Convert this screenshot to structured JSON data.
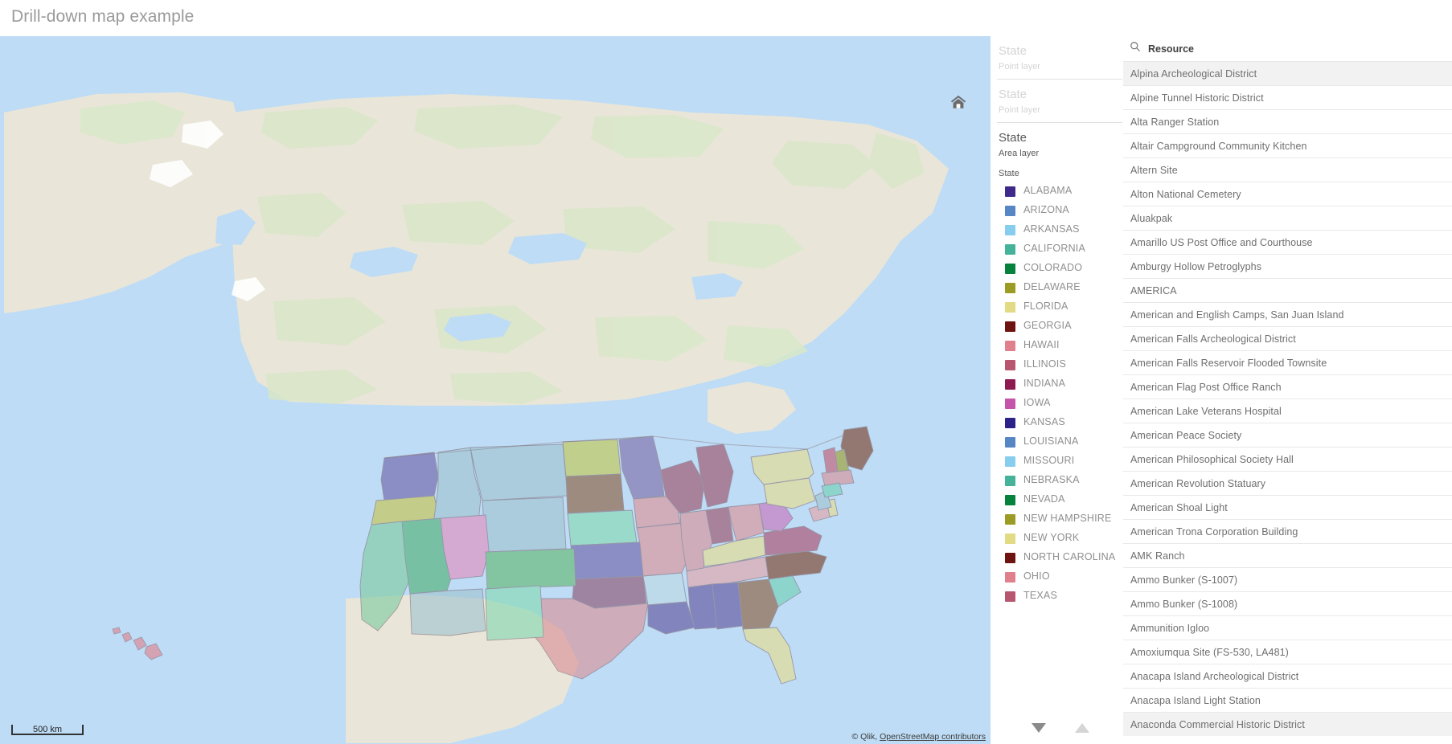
{
  "header": {
    "title": "Drill-down map example"
  },
  "map": {
    "home_icon": "home-icon",
    "scale_label": "500 km",
    "attribution_prefix": "© Qlik, ",
    "attribution_link": "OpenStreetMap contributors",
    "water_color": "#bedcf5",
    "land_color": "#e9e6d9",
    "green_color": "#d9e7c8"
  },
  "legend": {
    "groups": [
      {
        "title": "State",
        "subtitle": "Point layer",
        "dim": true
      },
      {
        "title": "State",
        "subtitle": "Point layer",
        "dim": true
      },
      {
        "title": "State",
        "subtitle": "Area layer",
        "dim": false,
        "dimension_name": "State"
      }
    ],
    "items": [
      {
        "label": "ALABAMA",
        "color": "#3f2a8c"
      },
      {
        "label": "ARIZONA",
        "color": "#5786c5"
      },
      {
        "label": "ARKANSAS",
        "color": "#87cdee"
      },
      {
        "label": "CALIFORNIA",
        "color": "#45b39a"
      },
      {
        "label": "COLORADO",
        "color": "#07823c"
      },
      {
        "label": "DELAWARE",
        "color": "#9c9c24"
      },
      {
        "label": "FLORIDA",
        "color": "#e3da84"
      },
      {
        "label": "GEORGIA",
        "color": "#6e1410"
      },
      {
        "label": "HAWAII",
        "color": "#e0808c"
      },
      {
        "label": "ILLINOIS",
        "color": "#b8566f"
      },
      {
        "label": "INDIANA",
        "color": "#8d1b52"
      },
      {
        "label": "IOWA",
        "color": "#c555ab"
      },
      {
        "label": "KANSAS",
        "color": "#2d2287"
      },
      {
        "label": "LOUISIANA",
        "color": "#5786c5"
      },
      {
        "label": "MISSOURI",
        "color": "#87cdee"
      },
      {
        "label": "NEBRASKA",
        "color": "#45b39a"
      },
      {
        "label": "NEVADA",
        "color": "#07823c"
      },
      {
        "label": "NEW HAMPSHIRE",
        "color": "#9c9c24"
      },
      {
        "label": "NEW YORK",
        "color": "#e3da84"
      },
      {
        "label": "NORTH CAROLINA",
        "color": "#6e1410"
      },
      {
        "label": "OHIO",
        "color": "#e0808c"
      },
      {
        "label": "TEXAS",
        "color": "#b8566f"
      }
    ],
    "nav": {
      "down": "scroll-down-arrow",
      "up": "scroll-up-arrow"
    }
  },
  "resource": {
    "search_icon": "search-icon",
    "title": "Resource",
    "items": [
      {
        "label": "Alpina Archeological District",
        "highlighted": true
      },
      {
        "label": "Alpine Tunnel Historic District",
        "highlighted": false
      },
      {
        "label": "Alta Ranger Station",
        "highlighted": false
      },
      {
        "label": "Altair Campground Community Kitchen",
        "highlighted": false
      },
      {
        "label": "Altern Site",
        "highlighted": false
      },
      {
        "label": "Alton National Cemetery",
        "highlighted": false
      },
      {
        "label": "Aluakpak",
        "highlighted": false
      },
      {
        "label": "Amarillo US Post Office and Courthouse",
        "highlighted": false
      },
      {
        "label": "Amburgy Hollow Petroglyphs",
        "highlighted": false
      },
      {
        "label": "AMERICA",
        "highlighted": false
      },
      {
        "label": "American and English Camps, San Juan Island",
        "highlighted": false
      },
      {
        "label": "American Falls Archeological District",
        "highlighted": false
      },
      {
        "label": "American Falls Reservoir Flooded Townsite",
        "highlighted": false
      },
      {
        "label": "American Flag Post Office Ranch",
        "highlighted": false
      },
      {
        "label": "American Lake Veterans Hospital",
        "highlighted": false
      },
      {
        "label": "American Peace Society",
        "highlighted": false
      },
      {
        "label": "American Philosophical Society Hall",
        "highlighted": false
      },
      {
        "label": "American Revolution Statuary",
        "highlighted": false
      },
      {
        "label": "American Shoal Light",
        "highlighted": false
      },
      {
        "label": "American Trona Corporation Building",
        "highlighted": false
      },
      {
        "label": "AMK Ranch",
        "highlighted": false
      },
      {
        "label": "Ammo Bunker (S-1007)",
        "highlighted": false
      },
      {
        "label": "Ammo Bunker (S-1008)",
        "highlighted": false
      },
      {
        "label": "Ammunition Igloo",
        "highlighted": false
      },
      {
        "label": "Amoxiumqua Site (FS-530, LA481)",
        "highlighted": false
      },
      {
        "label": "Anacapa Island Archeological District",
        "highlighted": false
      },
      {
        "label": "Anacapa Island Light Station",
        "highlighted": false
      },
      {
        "label": "Anaconda Commercial Historic District",
        "highlighted": true
      }
    ]
  }
}
